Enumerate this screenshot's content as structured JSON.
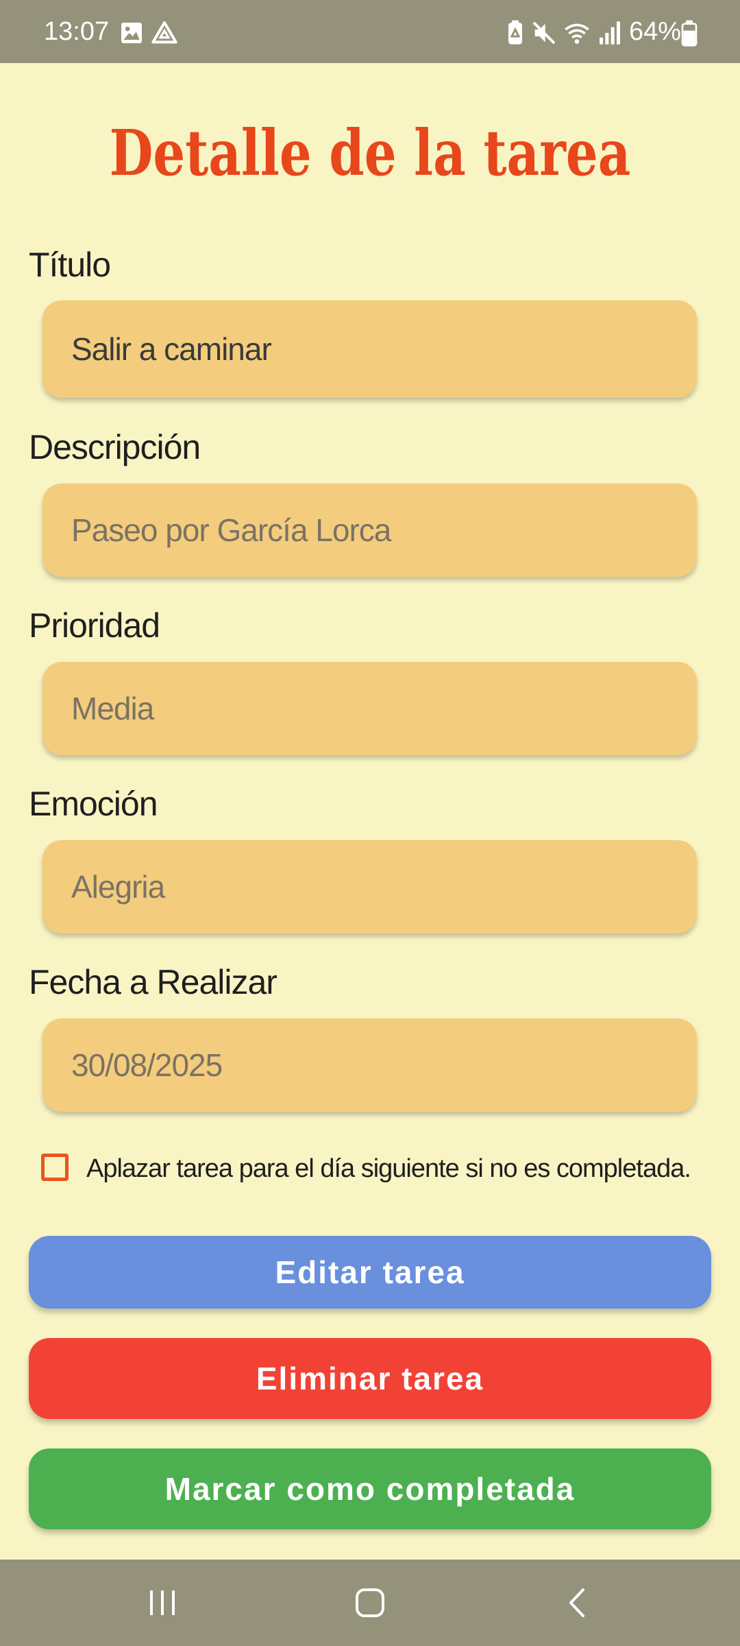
{
  "status_bar": {
    "time": "13:07",
    "battery_percent": "64%",
    "left_icons": [
      "image-icon",
      "drive-icon"
    ],
    "right_icons": [
      "battery-saver-icon",
      "mute-icon",
      "wifi-icon",
      "signal-icon",
      "battery-icon"
    ]
  },
  "page": {
    "title": "Detalle de la tarea"
  },
  "form": {
    "titulo": {
      "label": "Título",
      "value": "Salir a caminar"
    },
    "descripcion": {
      "label": "Descripción",
      "value": "Paseo por García Lorca"
    },
    "prioridad": {
      "label": "Prioridad",
      "value": "Media"
    },
    "emocion": {
      "label": "Emoción",
      "value": "Alegria"
    },
    "fecha": {
      "label": "Fecha a Realizar",
      "value": "30/08/2025"
    },
    "postpone": {
      "label": "Aplazar tarea para el día siguiente si no es completada.",
      "checked": false
    }
  },
  "actions": {
    "edit": "Editar tarea",
    "delete": "Eliminar tarea",
    "complete": "Marcar como completada"
  },
  "nav_bar": {
    "icons": [
      "recent-apps-icon",
      "home-icon",
      "back-icon"
    ]
  },
  "colors": {
    "background": "#f8f4c4",
    "title": "#e8461b",
    "field": "#f3cd7d",
    "edit_button": "#6a8fdc",
    "delete_button": "#f24236",
    "complete_button": "#4cb050",
    "system_bars": "#94927a"
  }
}
